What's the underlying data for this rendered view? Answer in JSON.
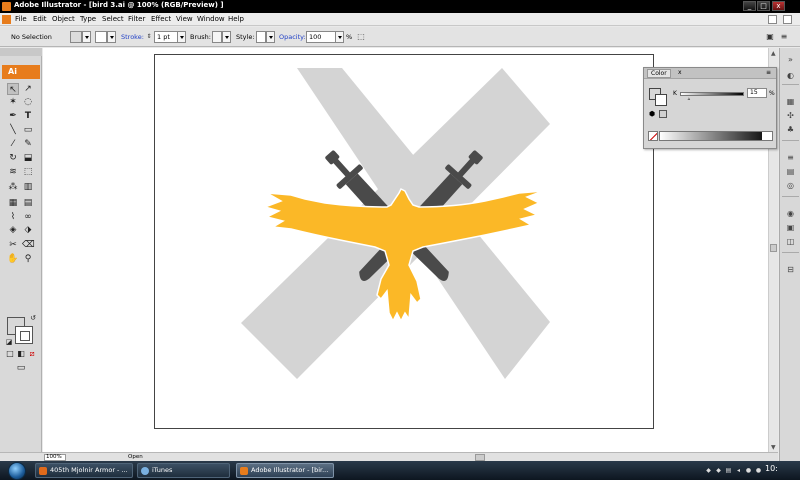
{
  "window": {
    "title": "Adobe Illustrator - [bird 3.ai @ 100% (RGB/Preview) ]",
    "min": "_",
    "max": "□",
    "close": "x"
  },
  "menu": [
    "File",
    "Edit",
    "Object",
    "Type",
    "Select",
    "Filter",
    "Effect",
    "View",
    "Window",
    "Help"
  ],
  "control": {
    "selection": "No Selection",
    "stroke_label": "Stroke:",
    "stroke_value": "1 pt",
    "brush_label": "Brush:",
    "style_label": "Style:",
    "opacity_label": "Opacity:",
    "opacity_value": "100",
    "opacity_unit": "%"
  },
  "tools_panel": {
    "badge": "Ai"
  },
  "color_panel": {
    "tab": "Color",
    "close": "x",
    "channel": "K",
    "value": "15",
    "unit": "%",
    "k_percent": 15
  },
  "status": {
    "zoom": "100%",
    "state": "Open"
  },
  "taskbar": {
    "tasks": [
      "405th Mjolnir Armor - ...",
      "iTunes",
      "Adobe Illustrator - [bir..."
    ],
    "clock": "10:"
  },
  "colors": {
    "x_shape": "#d4d4d4",
    "daggers": "#4a4a4a",
    "bird": "#fbb827",
    "app_accent": "#e77c1c"
  }
}
